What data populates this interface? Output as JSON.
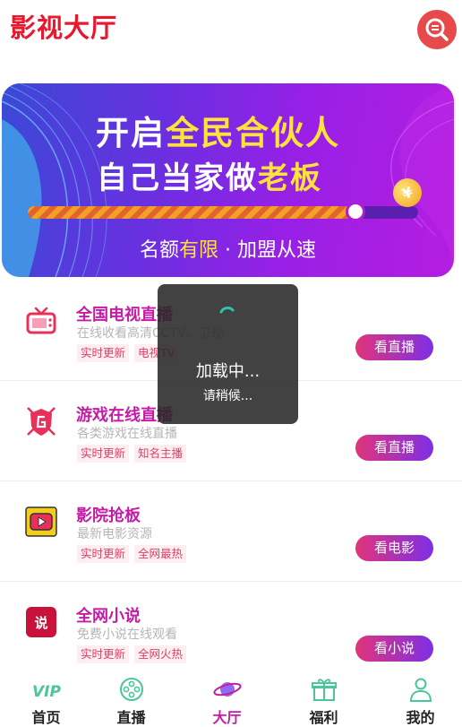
{
  "header": {
    "title": "影视大厅",
    "search_icon": "search-icon"
  },
  "banner": {
    "line1_a": "开启",
    "line1_b": "全民合伙人",
    "line2_a": "自己当家做",
    "line2_b": "老板",
    "tagline_a": "名额",
    "tagline_b": "有限",
    "tagline_c": " · 加盟从速",
    "progress": 0.84,
    "coin_symbol": "¥"
  },
  "list": [
    {
      "title": "全国电视直播",
      "desc": "在线收看高清CCTV、卫视",
      "tags": [
        "实时更新",
        "电视TV"
      ],
      "action": "看直播",
      "icon": "tv-icon",
      "icon_color": "#e8305a"
    },
    {
      "title": "游戏在线直播",
      "desc": "各类游戏在线直播",
      "tags": [
        "实时更新",
        "知名主播"
      ],
      "action": "看直播",
      "icon": "game-shield-icon",
      "icon_color": "#e8305a"
    },
    {
      "title": "影院抢板",
      "desc": "最新电影资源",
      "tags": [
        "实时更新",
        "全网最热"
      ],
      "action": "看电影",
      "icon": "video-play-icon",
      "icon_color": "#f5cc1b"
    },
    {
      "title": "全网小说",
      "desc": "免费小说在线观看",
      "tags": [
        "实时更新",
        "全网火热"
      ],
      "action": "看小说",
      "icon": "novel-icon",
      "icon_color": "#c8123a"
    }
  ],
  "loading": {
    "title": "加载中...",
    "subtitle": "请稍候..."
  },
  "tabs": [
    {
      "label": "首页",
      "icon": "vip-icon",
      "active": false
    },
    {
      "label": "直播",
      "icon": "film-reel-icon",
      "active": false
    },
    {
      "label": "大厅",
      "icon": "planet-icon",
      "active": true
    },
    {
      "label": "福利",
      "icon": "gift-icon",
      "active": false
    },
    {
      "label": "我的",
      "icon": "user-icon",
      "active": false
    }
  ],
  "colors": {
    "accent": "#c51ba6",
    "brand_red": "#e8192f",
    "button_gradient_start": "#e0357a",
    "button_gradient_end": "#7d2fe6"
  }
}
